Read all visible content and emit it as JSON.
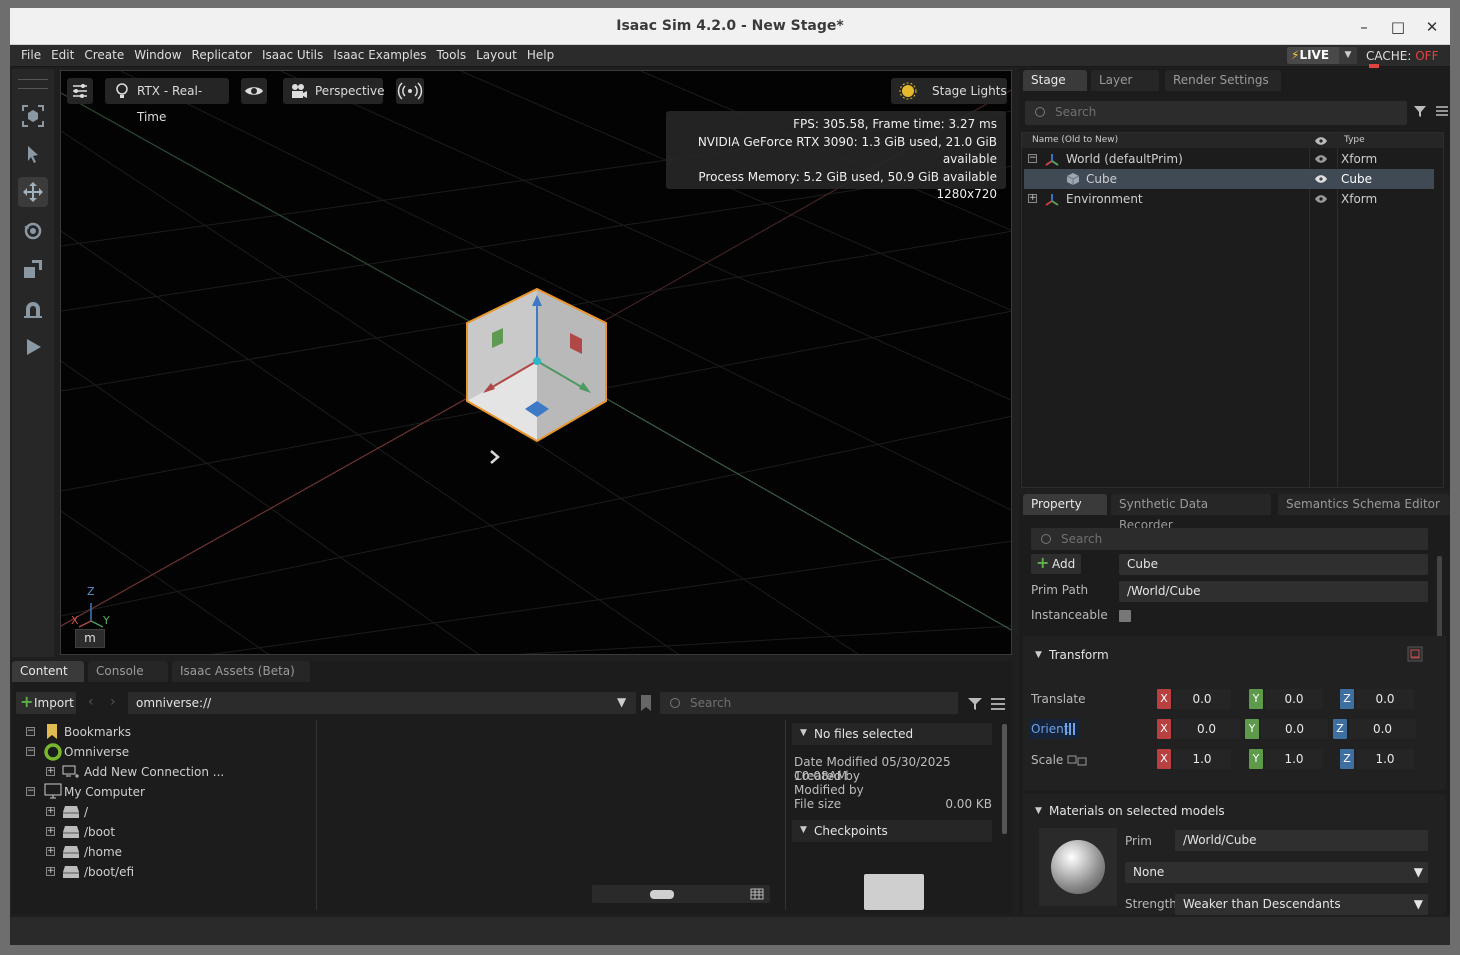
{
  "window": {
    "title": "Isaac Sim 4.2.0 - New Stage*"
  },
  "menu": [
    "File",
    "Edit",
    "Create",
    "Window",
    "Replicator",
    "Isaac Utils",
    "Isaac Examples",
    "Tools",
    "Layout",
    "Help"
  ],
  "status_right": {
    "live_label": "LIVE",
    "cache_label": "CACHE:",
    "cache_state": "OFF",
    "cache_off_color": "#e0443e"
  },
  "viewport": {
    "renderer": "RTX - Real-Time",
    "camera": "Perspective",
    "lights": "Stage Lights",
    "stats": [
      "FPS: 305.58, Frame time: 3.27 ms",
      "NVIDIA GeForce RTX 3090: 1.3 GiB used, 21.0 GiB available",
      "Process Memory: 5.2 GiB used, 50.9 GiB available",
      "1280x720"
    ],
    "axes": {
      "z": "Z",
      "x": "X",
      "y": "Y"
    },
    "m_button": "m"
  },
  "stage": {
    "tabs": [
      "Stage",
      "Layer",
      "Render Settings"
    ],
    "search_placeholder": "Search",
    "col_name": "Name (Old to New)",
    "col_type": "Type",
    "items": [
      {
        "name": "World (defaultPrim)",
        "type": "Xform",
        "expander": "−"
      },
      {
        "name": "Cube",
        "type": "Cube",
        "expander": ""
      },
      {
        "name": "Environment",
        "type": "Xform",
        "expander": "+"
      }
    ]
  },
  "property": {
    "tabs": [
      "Property",
      "Synthetic Data Recorder",
      "Semantics Schema Editor"
    ],
    "search_placeholder": "Search",
    "add_label": "Add",
    "name_value": "Cube",
    "prim_path_label": "Prim Path",
    "prim_path_value": "/World/Cube",
    "instanceable_label": "Instanceable",
    "transform_title": "Transform",
    "translate_label": "Translate",
    "orient_label": "Orient",
    "scale_label": "Scale",
    "axis_labels": [
      "X",
      "Y",
      "Z"
    ],
    "translate": [
      "0.0",
      "0.0",
      "0.0"
    ],
    "orient": [
      "0.0",
      "0.0",
      "0.0"
    ],
    "scale": [
      "1.0",
      "1.0",
      "1.0"
    ],
    "materials_title": "Materials on selected models",
    "mat_prim_label": "Prim",
    "mat_prim_value": "/World/Cube",
    "material_value": "None",
    "strength_label": "Strength",
    "strength_value": "Weaker than Descendants"
  },
  "content": {
    "tabs": [
      "Content",
      "Console",
      "Isaac Assets (Beta)"
    ],
    "import_label": "Import",
    "path_value": "omniverse://",
    "search_placeholder": "Search",
    "tree": [
      {
        "label": "Bookmarks",
        "exp": "−"
      },
      {
        "label": "Omniverse",
        "exp": "−"
      },
      {
        "label": "Add New Connection ...",
        "exp": "+"
      },
      {
        "label": "My Computer",
        "exp": "−"
      },
      {
        "label": "/",
        "exp": "+"
      },
      {
        "label": "/boot",
        "exp": "+"
      },
      {
        "label": "/home",
        "exp": "+"
      },
      {
        "label": "/boot/efi",
        "exp": "+"
      }
    ],
    "details": {
      "header": "No files selected",
      "date_modified": "Date Modified 05/30/2025 10:08AM",
      "created_by": "Created by",
      "modified_by": "Modified by",
      "file_size_label": "File size",
      "file_size_value": "0.00 KB",
      "checkpoints": "Checkpoints"
    }
  }
}
